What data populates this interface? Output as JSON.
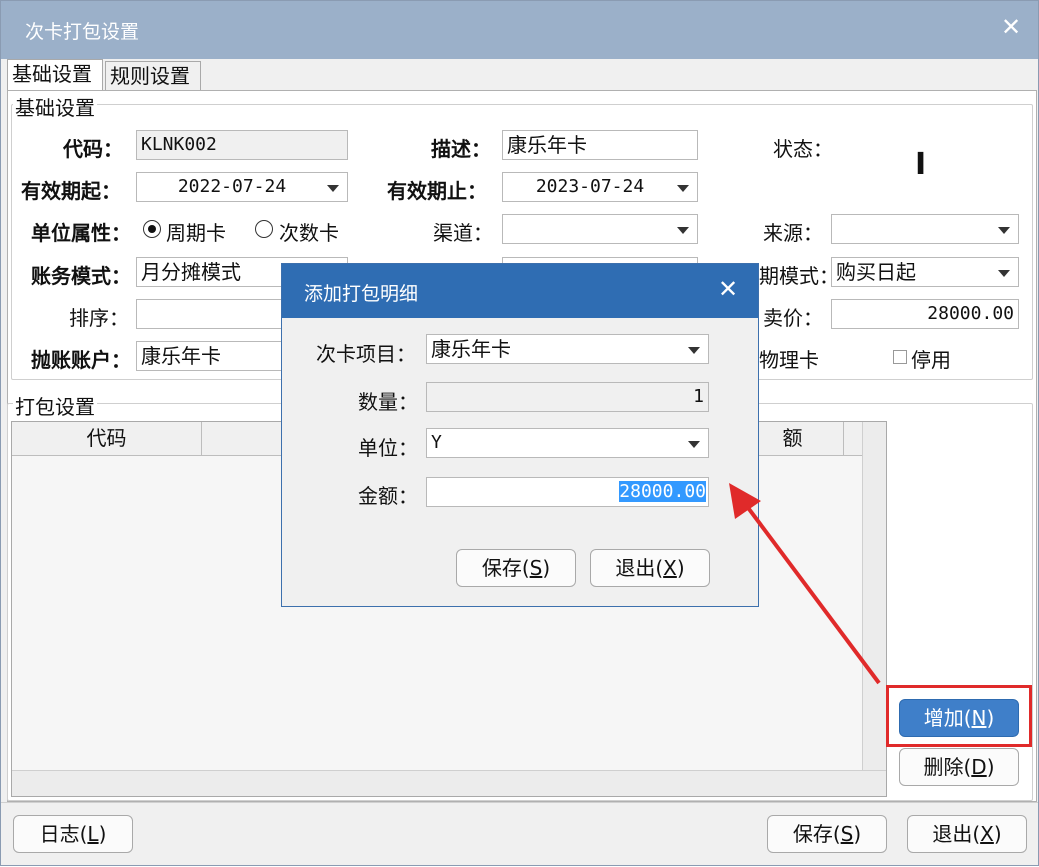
{
  "window": {
    "title": "次卡打包设置",
    "close_icon": "close-icon"
  },
  "tabs": [
    {
      "label": "基础设置",
      "active": true
    },
    {
      "label": "规则设置",
      "active": false
    }
  ],
  "basic": {
    "group_label": "基础设置",
    "code_label": "代码：",
    "code_value": "KLNK002",
    "desc_label": "描述：",
    "desc_value": "康乐年卡",
    "status_label": "状态：",
    "status_value": "I",
    "valid_from_label": "有效期起：",
    "valid_from_value": "2022-07-24",
    "valid_to_label": "有效期止：",
    "valid_to_value": "2023-07-24",
    "unit_attr_label": "单位属性：",
    "radio_period": "周期卡",
    "radio_count": "次数卡",
    "channel_label": "渠道：",
    "channel_value": "",
    "source_label": "来源：",
    "source_value": "",
    "account_mode_label": "账务模式：",
    "account_mode_value": "月分摊模式",
    "period_mode_label": "期模式：",
    "period_mode_value": "购买日起",
    "sort_label": "排序：",
    "sort_value": "",
    "price_label": "卖价：",
    "price_value": "28000.00",
    "account_label": "抛账账户：",
    "account_value": "康乐年卡",
    "physical_card_label": "物理卡",
    "disabled_label": "停用"
  },
  "package": {
    "group_label": "打包设置",
    "columns": [
      "代码",
      "",
      "额"
    ]
  },
  "side_buttons": {
    "add": "增加",
    "add_key": "N",
    "delete": "删除",
    "delete_key": "D"
  },
  "footer": {
    "log": "日志",
    "log_key": "L",
    "save": "保存",
    "save_key": "S",
    "exit": "退出",
    "exit_key": "X"
  },
  "modal": {
    "title": "添加打包明细",
    "item_label": "次卡项目：",
    "item_value": "康乐年卡",
    "qty_label": "数量：",
    "qty_value": "1",
    "unit_label": "单位：",
    "unit_value": "Y",
    "amount_label": "金额：",
    "amount_value": "28000.00",
    "save": "保存",
    "save_key": "S",
    "exit": "退出",
    "exit_key": "X"
  },
  "annotation_color": "#e02a2a"
}
